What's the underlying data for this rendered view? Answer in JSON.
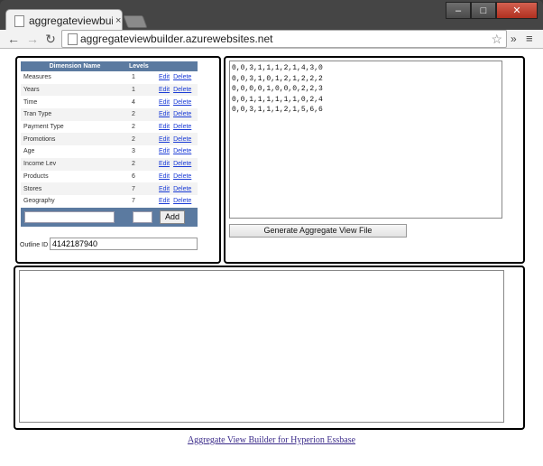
{
  "browser": {
    "tab_title": "aggregateviewbuilde",
    "tab_close": "×",
    "url": "aggregateviewbuilder.azurewebsites.net",
    "icons": [
      "back-arrow-icon",
      "forward-arrow-icon",
      "reload-icon",
      "star-icon",
      "menu-icon"
    ]
  },
  "dimensions_table": {
    "headers": [
      "Dimension Name",
      "Levels"
    ],
    "rows": [
      {
        "name": "Measures",
        "levels": "1",
        "edit": "Edit",
        "delete": "Delete"
      },
      {
        "name": "Years",
        "levels": "1",
        "edit": "Edit",
        "delete": "Delete"
      },
      {
        "name": "Time",
        "levels": "4",
        "edit": "Edit",
        "delete": "Delete"
      },
      {
        "name": "Tran Type",
        "levels": "2",
        "edit": "Edit",
        "delete": "Delete"
      },
      {
        "name": "Payment Type",
        "levels": "2",
        "edit": "Edit",
        "delete": "Delete"
      },
      {
        "name": "Promotions",
        "levels": "2",
        "edit": "Edit",
        "delete": "Delete"
      },
      {
        "name": "Age",
        "levels": "3",
        "edit": "Edit",
        "delete": "Delete"
      },
      {
        "name": "Income Lev",
        "levels": "2",
        "edit": "Edit",
        "delete": "Delete"
      },
      {
        "name": "Products",
        "levels": "6",
        "edit": "Edit",
        "delete": "Delete"
      },
      {
        "name": "Stores",
        "levels": "7",
        "edit": "Edit",
        "delete": "Delete"
      },
      {
        "name": "Geography",
        "levels": "7",
        "edit": "Edit",
        "delete": "Delete"
      }
    ],
    "add_button": "Add",
    "outline_label": "Outline ID",
    "outline_value": "4142187940"
  },
  "sequences": "0,0,3,1,1,1,2,1,4,3,0\n0,0,3,1,0,1,2,1,2,2,2\n0,0,0,0,1,0,0,0,2,2,3\n0,0,1,1,1,1,1,1,0,2,4\n0,0,3,1,1,1,2,1,5,6,6",
  "generate_button": "Generate Aggregate View File",
  "output_text": "",
  "footer_link": "Aggregate View Builder for Hyperion Essbase"
}
